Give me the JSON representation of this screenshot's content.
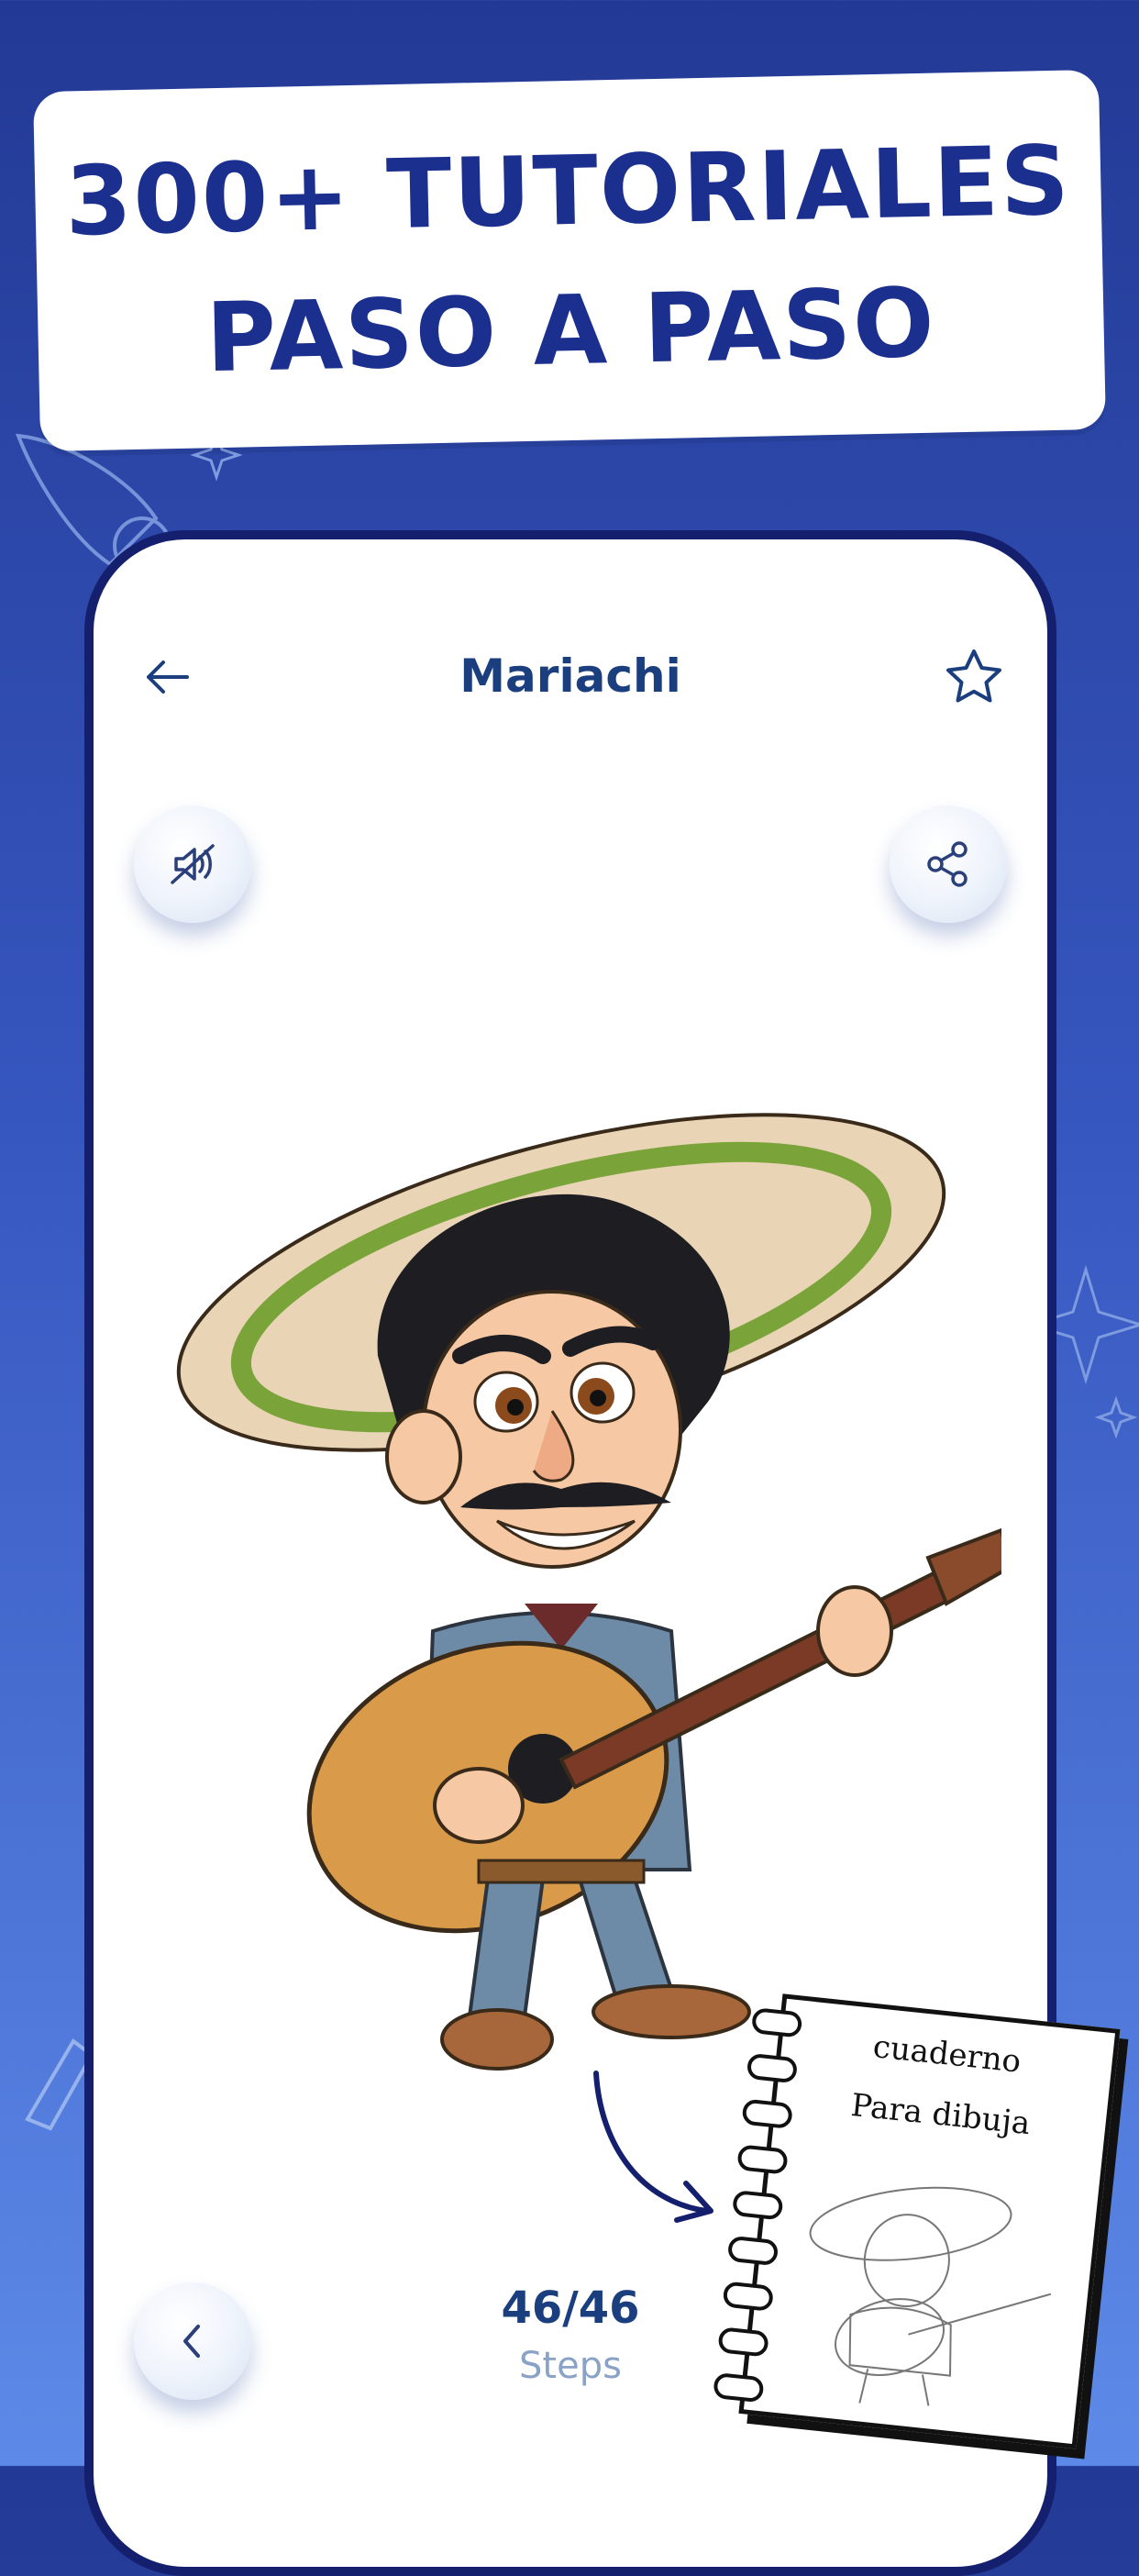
{
  "banner": {
    "line1": "300+ TUTORIALES",
    "line2": "PASO A PASO"
  },
  "header": {
    "title": "Mariachi",
    "back_icon": "arrow-left-icon",
    "favorite_icon": "star-icon"
  },
  "controls": {
    "mute_icon": "speaker-muted-icon",
    "share_icon": "share-icon",
    "prev_icon": "chevron-left-icon"
  },
  "steps": {
    "count": "46/46",
    "label": "Steps"
  },
  "notebook": {
    "line1": "cuaderno",
    "line2": "Para dibuja"
  },
  "colors": {
    "background_top": "#233a95",
    "background_bottom": "#5d8ae8",
    "banner_text": "#1b2f8e",
    "title_text": "#1b3f7e",
    "steps_label": "#8aa2c6",
    "phone_border": "#14206e"
  }
}
